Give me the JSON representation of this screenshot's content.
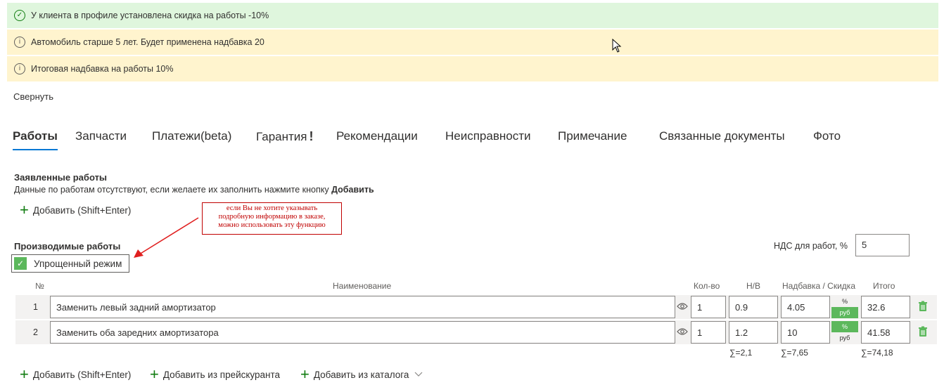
{
  "alerts": {
    "discount": "У клиента в профиле установлена скидка на работы -10%",
    "old_car": "Автомобиль старше 5 лет. Будет применена надбавка 20",
    "total_markup": "Итоговая надбавка на работы 10%"
  },
  "collapse_label": "Свернуть",
  "tabs": [
    {
      "label": "Работы",
      "active": true
    },
    {
      "label": "Запчасти"
    },
    {
      "label": "Платежи(beta)"
    },
    {
      "label": "Гарантия",
      "badge": "!"
    },
    {
      "label": "Рекомендации"
    },
    {
      "label": "Неисправности"
    },
    {
      "label": "Примечание"
    },
    {
      "label": "Связанные документы"
    },
    {
      "label": "Фото"
    }
  ],
  "declared": {
    "title": "Заявленные работы",
    "note_prefix": "Данные по работам отсутствуют, если желаете их заполнить нажмите кнопку ",
    "note_bold": "Добавить",
    "add_label": "Добавить (Shift+Enter)"
  },
  "callout": {
    "line1": "если Вы не хотите указывать",
    "line2": "подробную информацию в заказе,",
    "line3": "можно использовать эту функцию"
  },
  "performed": {
    "title": "Производимые работы",
    "simple_mode_label": "Упрощенный режим",
    "simple_mode_checked": true,
    "vat_label": "НДС для работ, %",
    "vat_value": "5"
  },
  "table": {
    "headers": {
      "num": "№",
      "name": "Наименование",
      "qty": "Кол-во",
      "nh": "Н/В",
      "markup": "Надбавка / Скидка",
      "total": "Итого"
    },
    "toggle": {
      "percent": "%",
      "rub": "руб"
    },
    "rows": [
      {
        "num": "1",
        "name": "Заменить левый задний амортизатор",
        "qty": "1",
        "nh": "0.9",
        "markup": "4.05",
        "mode": "rub",
        "total": "32.6"
      },
      {
        "num": "2",
        "name": "Заменить оба заредних амортизатора",
        "qty": "1",
        "nh": "1.2",
        "markup": "10",
        "mode": "percent",
        "total": "41.58"
      }
    ],
    "sums": {
      "nh": "∑=2,1",
      "markup": "∑=7,65",
      "total": "∑=74,18"
    }
  },
  "bottom_actions": {
    "add": "Добавить (Shift+Enter)",
    "add_price_list": "Добавить из прейскуранта",
    "add_catalog": "Добавить из каталога"
  },
  "colors": {
    "success_bg": "#dff6dd",
    "warning_bg": "#fff4ce",
    "accent": "#0078d4",
    "green": "#5cb85c",
    "callout_red": "#c00000"
  }
}
